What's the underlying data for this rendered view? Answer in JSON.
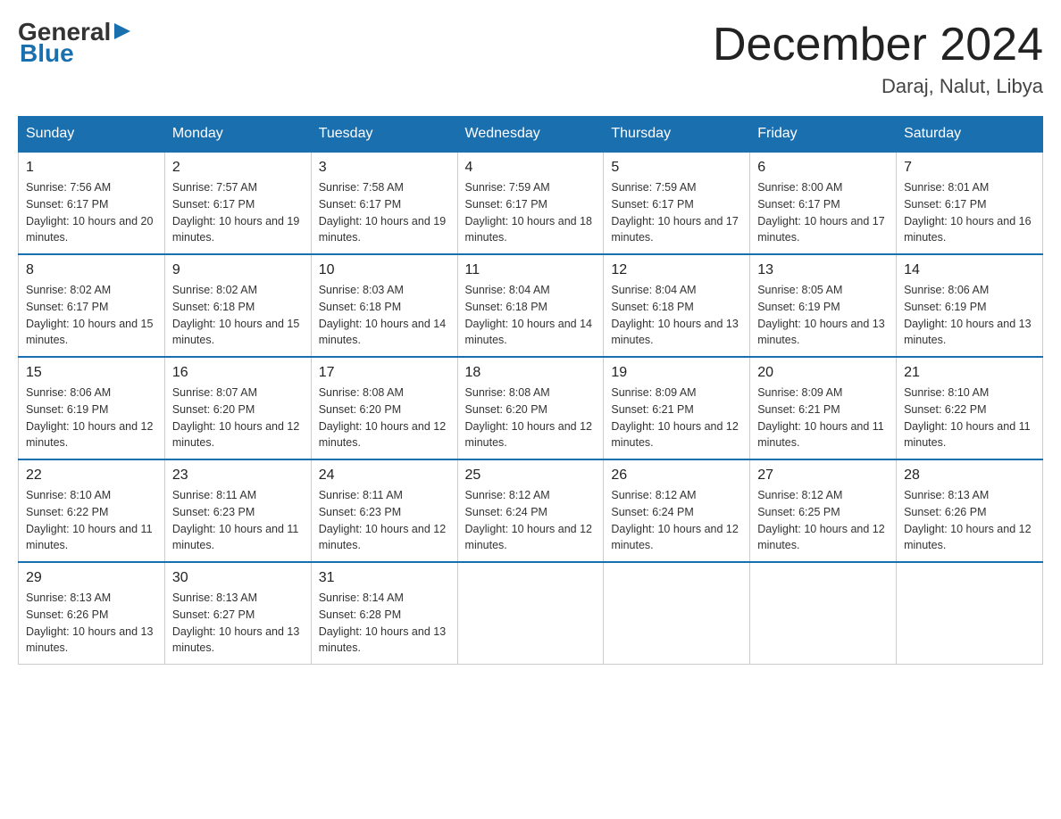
{
  "header": {
    "logo": {
      "general": "General",
      "blue": "Blue"
    },
    "title": "December 2024",
    "location": "Daraj, Nalut, Libya"
  },
  "days_of_week": [
    "Sunday",
    "Monday",
    "Tuesday",
    "Wednesday",
    "Thursday",
    "Friday",
    "Saturday"
  ],
  "weeks": [
    [
      {
        "day": "1",
        "sunrise": "7:56 AM",
        "sunset": "6:17 PM",
        "daylight": "10 hours and 20 minutes."
      },
      {
        "day": "2",
        "sunrise": "7:57 AM",
        "sunset": "6:17 PM",
        "daylight": "10 hours and 19 minutes."
      },
      {
        "day": "3",
        "sunrise": "7:58 AM",
        "sunset": "6:17 PM",
        "daylight": "10 hours and 19 minutes."
      },
      {
        "day": "4",
        "sunrise": "7:59 AM",
        "sunset": "6:17 PM",
        "daylight": "10 hours and 18 minutes."
      },
      {
        "day": "5",
        "sunrise": "7:59 AM",
        "sunset": "6:17 PM",
        "daylight": "10 hours and 17 minutes."
      },
      {
        "day": "6",
        "sunrise": "8:00 AM",
        "sunset": "6:17 PM",
        "daylight": "10 hours and 17 minutes."
      },
      {
        "day": "7",
        "sunrise": "8:01 AM",
        "sunset": "6:17 PM",
        "daylight": "10 hours and 16 minutes."
      }
    ],
    [
      {
        "day": "8",
        "sunrise": "8:02 AM",
        "sunset": "6:17 PM",
        "daylight": "10 hours and 15 minutes."
      },
      {
        "day": "9",
        "sunrise": "8:02 AM",
        "sunset": "6:18 PM",
        "daylight": "10 hours and 15 minutes."
      },
      {
        "day": "10",
        "sunrise": "8:03 AM",
        "sunset": "6:18 PM",
        "daylight": "10 hours and 14 minutes."
      },
      {
        "day": "11",
        "sunrise": "8:04 AM",
        "sunset": "6:18 PM",
        "daylight": "10 hours and 14 minutes."
      },
      {
        "day": "12",
        "sunrise": "8:04 AM",
        "sunset": "6:18 PM",
        "daylight": "10 hours and 13 minutes."
      },
      {
        "day": "13",
        "sunrise": "8:05 AM",
        "sunset": "6:19 PM",
        "daylight": "10 hours and 13 minutes."
      },
      {
        "day": "14",
        "sunrise": "8:06 AM",
        "sunset": "6:19 PM",
        "daylight": "10 hours and 13 minutes."
      }
    ],
    [
      {
        "day": "15",
        "sunrise": "8:06 AM",
        "sunset": "6:19 PM",
        "daylight": "10 hours and 12 minutes."
      },
      {
        "day": "16",
        "sunrise": "8:07 AM",
        "sunset": "6:20 PM",
        "daylight": "10 hours and 12 minutes."
      },
      {
        "day": "17",
        "sunrise": "8:08 AM",
        "sunset": "6:20 PM",
        "daylight": "10 hours and 12 minutes."
      },
      {
        "day": "18",
        "sunrise": "8:08 AM",
        "sunset": "6:20 PM",
        "daylight": "10 hours and 12 minutes."
      },
      {
        "day": "19",
        "sunrise": "8:09 AM",
        "sunset": "6:21 PM",
        "daylight": "10 hours and 12 minutes."
      },
      {
        "day": "20",
        "sunrise": "8:09 AM",
        "sunset": "6:21 PM",
        "daylight": "10 hours and 11 minutes."
      },
      {
        "day": "21",
        "sunrise": "8:10 AM",
        "sunset": "6:22 PM",
        "daylight": "10 hours and 11 minutes."
      }
    ],
    [
      {
        "day": "22",
        "sunrise": "8:10 AM",
        "sunset": "6:22 PM",
        "daylight": "10 hours and 11 minutes."
      },
      {
        "day": "23",
        "sunrise": "8:11 AM",
        "sunset": "6:23 PM",
        "daylight": "10 hours and 11 minutes."
      },
      {
        "day": "24",
        "sunrise": "8:11 AM",
        "sunset": "6:23 PM",
        "daylight": "10 hours and 12 minutes."
      },
      {
        "day": "25",
        "sunrise": "8:12 AM",
        "sunset": "6:24 PM",
        "daylight": "10 hours and 12 minutes."
      },
      {
        "day": "26",
        "sunrise": "8:12 AM",
        "sunset": "6:24 PM",
        "daylight": "10 hours and 12 minutes."
      },
      {
        "day": "27",
        "sunrise": "8:12 AM",
        "sunset": "6:25 PM",
        "daylight": "10 hours and 12 minutes."
      },
      {
        "day": "28",
        "sunrise": "8:13 AM",
        "sunset": "6:26 PM",
        "daylight": "10 hours and 12 minutes."
      }
    ],
    [
      {
        "day": "29",
        "sunrise": "8:13 AM",
        "sunset": "6:26 PM",
        "daylight": "10 hours and 13 minutes."
      },
      {
        "day": "30",
        "sunrise": "8:13 AM",
        "sunset": "6:27 PM",
        "daylight": "10 hours and 13 minutes."
      },
      {
        "day": "31",
        "sunrise": "8:14 AM",
        "sunset": "6:28 PM",
        "daylight": "10 hours and 13 minutes."
      },
      null,
      null,
      null,
      null
    ]
  ]
}
